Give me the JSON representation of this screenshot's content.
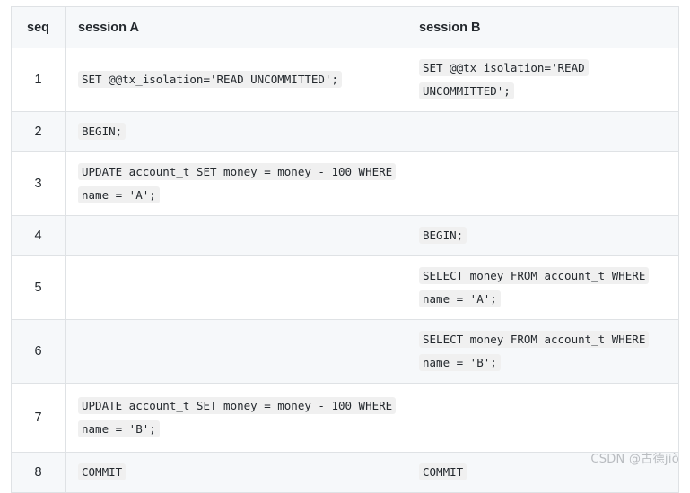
{
  "table": {
    "columns": [
      {
        "key": "seq",
        "label": "seq"
      },
      {
        "key": "session_a",
        "label": "session A"
      },
      {
        "key": "session_b",
        "label": "session B"
      }
    ],
    "rows": [
      {
        "seq": "1",
        "session_a": "SET @@tx_isolation='READ UNCOMMITTED';",
        "session_b": "SET @@tx_isolation='READ UNCOMMITTED';"
      },
      {
        "seq": "2",
        "session_a": "BEGIN;",
        "session_b": ""
      },
      {
        "seq": "3",
        "session_a": "UPDATE account_t SET money = money - 100 WHERE name = 'A';",
        "session_b": ""
      },
      {
        "seq": "4",
        "session_a": "",
        "session_b": "BEGIN;"
      },
      {
        "seq": "5",
        "session_a": "",
        "session_b": "SELECT money FROM account_t WHERE name = 'A';"
      },
      {
        "seq": "6",
        "session_a": "",
        "session_b": "SELECT money FROM account_t WHERE name = 'B';"
      },
      {
        "seq": "7",
        "session_a": "UPDATE account_t SET money = money - 100 WHERE name = 'B';",
        "session_b": ""
      },
      {
        "seq": "8",
        "session_a": "COMMIT",
        "session_b": "COMMIT"
      }
    ]
  },
  "watermark": {
    "text": "CSDN @古德jiò"
  },
  "colors": {
    "border": "#dfe2e5",
    "header_bg": "#f6f8fa",
    "stripe_bg": "#f6f8fa",
    "code_bg": "#f0f0f0",
    "text": "#24292e",
    "watermark": "#b9bcc0"
  }
}
